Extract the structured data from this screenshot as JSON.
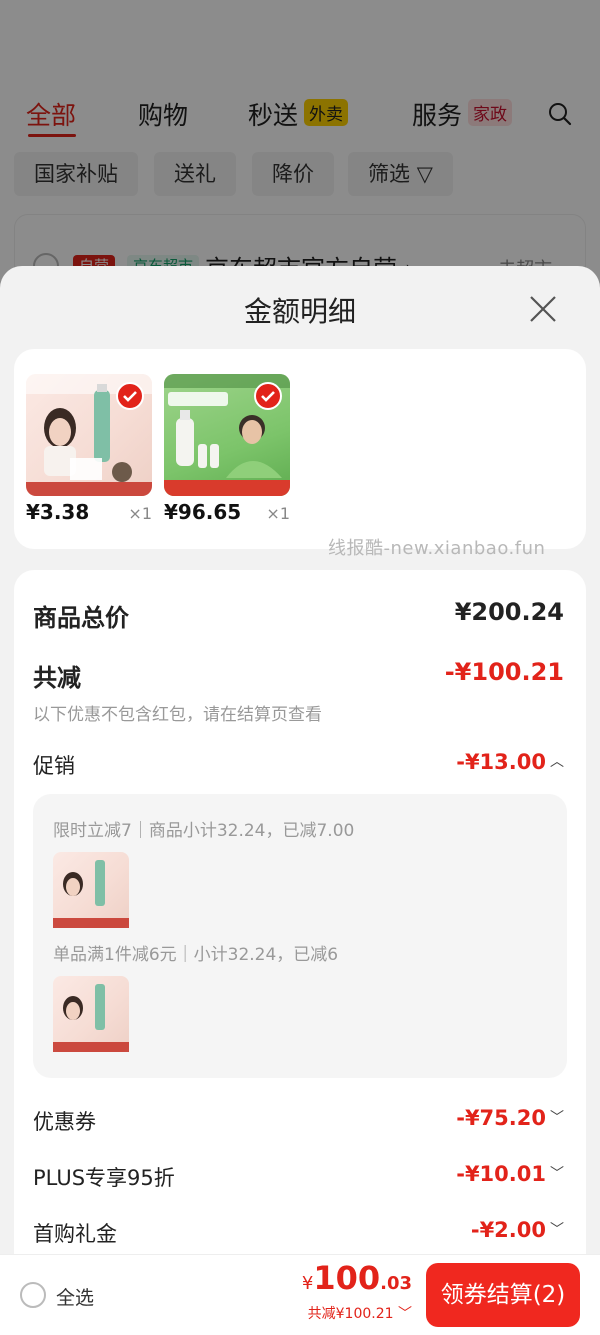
{
  "background": {
    "tabs": [
      {
        "label": "全部"
      },
      {
        "label": "购物"
      },
      {
        "label": "秒送",
        "tag": "外卖"
      },
      {
        "label": "服务",
        "tag": "家政"
      }
    ],
    "chips": [
      "国家补贴",
      "送礼",
      "降价",
      "筛选"
    ],
    "store": {
      "self_tag": "自营",
      "market_tag": "京东超市",
      "name": "京东超市官方自营 ›",
      "link": "去超市 ›"
    }
  },
  "sheet": {
    "title": "金额明细",
    "products": [
      {
        "price": "¥3.38",
        "qty": "×1"
      },
      {
        "price": "¥96.65",
        "qty": "×1"
      }
    ],
    "watermark": "线报酷-new.xianbao.fun",
    "total_label": "商品总价",
    "total_value": "¥200.24",
    "discount_label": "共减",
    "discount_value": "-¥100.21",
    "discount_note": "以下优惠不包含红包，请在结算页查看",
    "promo_label": "促销",
    "promo_value": "-¥13.00",
    "promo_lines": [
      "限时立减7｜商品小计32.24，已减7.00",
      "单品满1件减6元｜小计32.24，已减6"
    ],
    "coupon_label": "优惠券",
    "coupon_value": "-¥75.20",
    "plus_label": "PLUS专享95折",
    "plus_value": "-¥10.01",
    "firstbuy_label": "首购礼金",
    "firstbuy_value": "-¥2.00"
  },
  "bottom_bar": {
    "select_all": "全选",
    "currency": "¥",
    "total_int": "100",
    "total_dec": ".03",
    "saved": "共减¥100.21",
    "checkout": "领券结算(2)"
  },
  "colors": {
    "accent": "#e2231a",
    "checkout": "#f0281f"
  }
}
